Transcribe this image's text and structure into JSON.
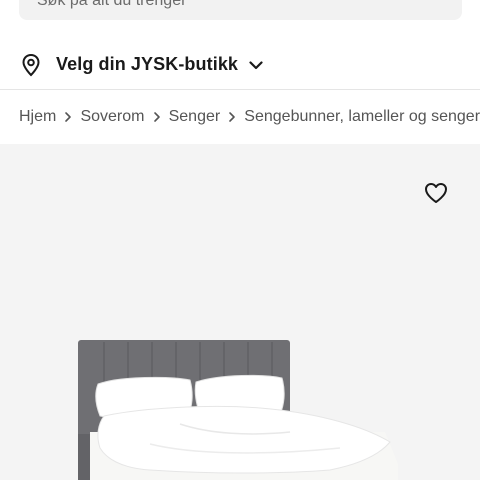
{
  "search": {
    "placeholder": "Søk på alt du trenger"
  },
  "store": {
    "label": "Velg din JYSK-butikk"
  },
  "breadcrumb": [
    {
      "label": "Hjem"
    },
    {
      "label": "Soverom"
    },
    {
      "label": "Senger"
    },
    {
      "label": "Sengebunner, lameller og senger"
    }
  ],
  "colors": {
    "brand_text": "#1a1a1a",
    "muted_text": "#555555",
    "image_background": "#f4f4f4",
    "headboard": "#6f6f73"
  },
  "icons": {
    "search": "search-icon",
    "location": "location-pin-icon",
    "dropdown": "chevron-down-icon",
    "separator": "chevron-right-icon",
    "favorite": "heart-icon"
  }
}
